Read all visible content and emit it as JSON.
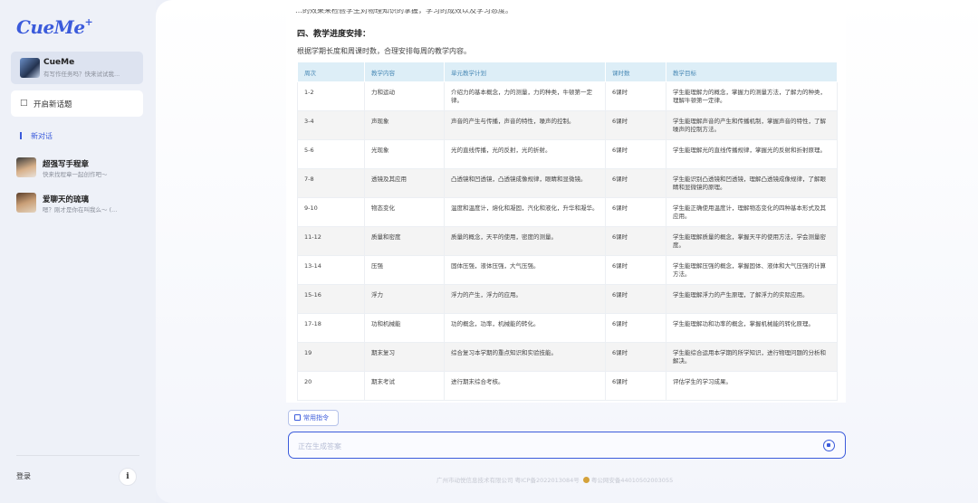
{
  "sidebar": {
    "logo": "CueMe",
    "logo_star": "+",
    "bot": {
      "name": "CueMe",
      "desc": "有写作任务吗？快来试试我..."
    },
    "new_topic_label": "开启新话题",
    "new_chat_label": "新对话",
    "conversations": [
      {
        "title": "超强写手程章",
        "desc": "快来找程章一起创作吧～"
      },
      {
        "title": "爱聊天的琉璃",
        "desc": "嗯？刚才是你在叫我么～ (..."
      }
    ],
    "login_label": "登录",
    "info_icon": "i"
  },
  "content": {
    "cut_line": "…的效果来检验学生对物理知识的掌握，学习的成效以及学习态度。",
    "section_head": "四、教学进度安排：",
    "section_intro": "根据学期长度和周课时数，合理安排每周的教学内容。",
    "table": {
      "headers": [
        "周次",
        "教学内容",
        "单元教学计划",
        "课时数",
        "教学目标"
      ],
      "rows": [
        [
          "1-2",
          "力和运动",
          "介绍力的基本概念，力的测量，力的种类，牛顿第一定律。",
          "6课时",
          "学生能理解力的概念，掌握力的测量方法，了解力的种类，理解牛顿第一定律。"
        ],
        [
          "3-4",
          "声现象",
          "声音的产生与传播，声音的特性，噪声的控制。",
          "6课时",
          "学生能理解声音的产生和传播机制，掌握声音的特性，了解噪声的控制方法。"
        ],
        [
          "5-6",
          "光现象",
          "光的直线传播，光的反射，光的折射。",
          "6课时",
          "学生能理解光的直线传播规律，掌握光的反射和折射原理。"
        ],
        [
          "7-8",
          "透镜及其应用",
          "凸透镜和凹透镜，凸透镜成像规律，眼睛和显微镜。",
          "6课时",
          "学生能识别凸透镜和凹透镜，理解凸透镜成像规律，了解眼睛和显微镜的原理。"
        ],
        [
          "9-10",
          "物态变化",
          "温度和温度计，熔化和凝固，汽化和液化，升华和凝华。",
          "6课时",
          "学生能正确使用温度计，理解物态变化的四种基本形式及其应用。"
        ],
        [
          "11-12",
          "质量和密度",
          "质量的概念，天平的使用，密度的测量。",
          "6课时",
          "学生能理解质量的概念，掌握天平的使用方法，学会测量密度。"
        ],
        [
          "13-14",
          "压强",
          "固体压强，液体压强，大气压强。",
          "6课时",
          "学生能理解压强的概念，掌握固体、液体和大气压强的计算方法。"
        ],
        [
          "15-16",
          "浮力",
          "浮力的产生，浮力的应用。",
          "6课时",
          "学生能理解浮力的产生原理，了解浮力的实际应用。"
        ],
        [
          "17-18",
          "功和机械能",
          "功的概念，功率，机械能的转化。",
          "6课时",
          "学生能理解功和功率的概念，掌握机械能的转化原理。"
        ],
        [
          "19",
          "期末复习",
          "综合复习本学期的重点知识和实验技能。",
          "6课时",
          "学生能综合运用本学期的所学知识，进行物理问题的分析和解决。"
        ],
        [
          "20",
          "期末考试",
          "进行期末综合考核。",
          "6课时",
          "评估学生的学习成果。"
        ]
      ]
    }
  },
  "composer": {
    "commands_label": "常用指令",
    "input_placeholder": "正在生成答案"
  },
  "footer": {
    "company": "广州市动悦信息技术有限公司",
    "icp": "粤ICP备2022013084号",
    "police": "粤公网安备44010502003055"
  },
  "colors": {
    "accent": "#3b5bdb",
    "table_header_bg": "#ddeef7",
    "table_header_text": "#4a8ab6"
  }
}
